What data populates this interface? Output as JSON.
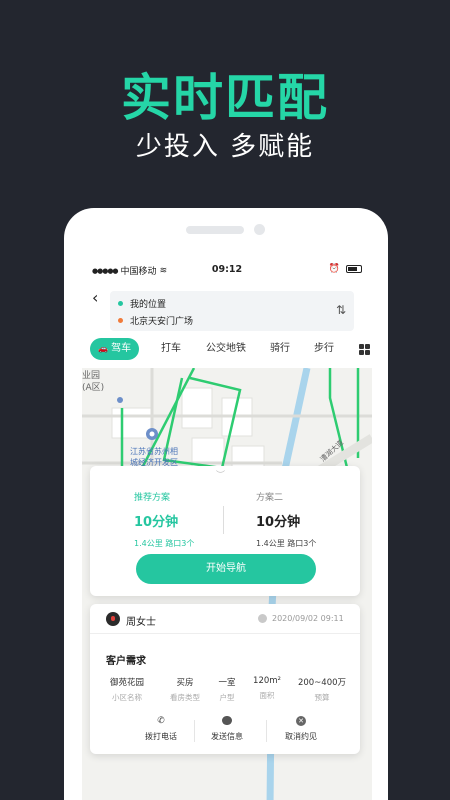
{
  "headline": "实时匹配",
  "subhead": "少投入 多赋能",
  "status_bar": {
    "carrier": "中国移动",
    "time": "09:12"
  },
  "route": {
    "origin": "我的位置",
    "destination": "北京天安门广场"
  },
  "tabs": [
    {
      "label": "驾车",
      "active": true
    },
    {
      "label": "打车"
    },
    {
      "label": "公交地铁"
    },
    {
      "label": "骑行"
    },
    {
      "label": "步行"
    }
  ],
  "map_labels": {
    "area1": "业园",
    "area2": "(A区)",
    "place1": "江苏省苏州相",
    "place2": "城经济开发区",
    "road": "漕湖大道"
  },
  "plans": [
    {
      "name": "推荐方案",
      "duration": "10分钟",
      "meta": "1.4公里 路口3个"
    },
    {
      "name": "方案二",
      "duration": "10分钟",
      "meta": "1.4公里 路口3个"
    }
  ],
  "navigate_button": "开始导航",
  "customer": {
    "name": "周女士",
    "time": "2020/09/02 09:11",
    "needs_title": "客户需求",
    "specs": [
      {
        "value": "御苑花园",
        "label": "小区名称"
      },
      {
        "value": "买房",
        "label": "看房类型"
      },
      {
        "value": "一室",
        "label": "户型"
      },
      {
        "value": "120m²",
        "label": "面积"
      },
      {
        "value": "200~400万",
        "label": "预算"
      }
    ],
    "actions": [
      {
        "label": "拨打电话",
        "icon": "phone-icon"
      },
      {
        "label": "发送信息",
        "icon": "message-icon"
      },
      {
        "label": "取消约见",
        "icon": "cancel-icon"
      }
    ]
  },
  "colors": {
    "accent": "#25c6a0",
    "headline": "#25d6a7",
    "background": "#23262f",
    "route_line": "#2ecc71"
  }
}
